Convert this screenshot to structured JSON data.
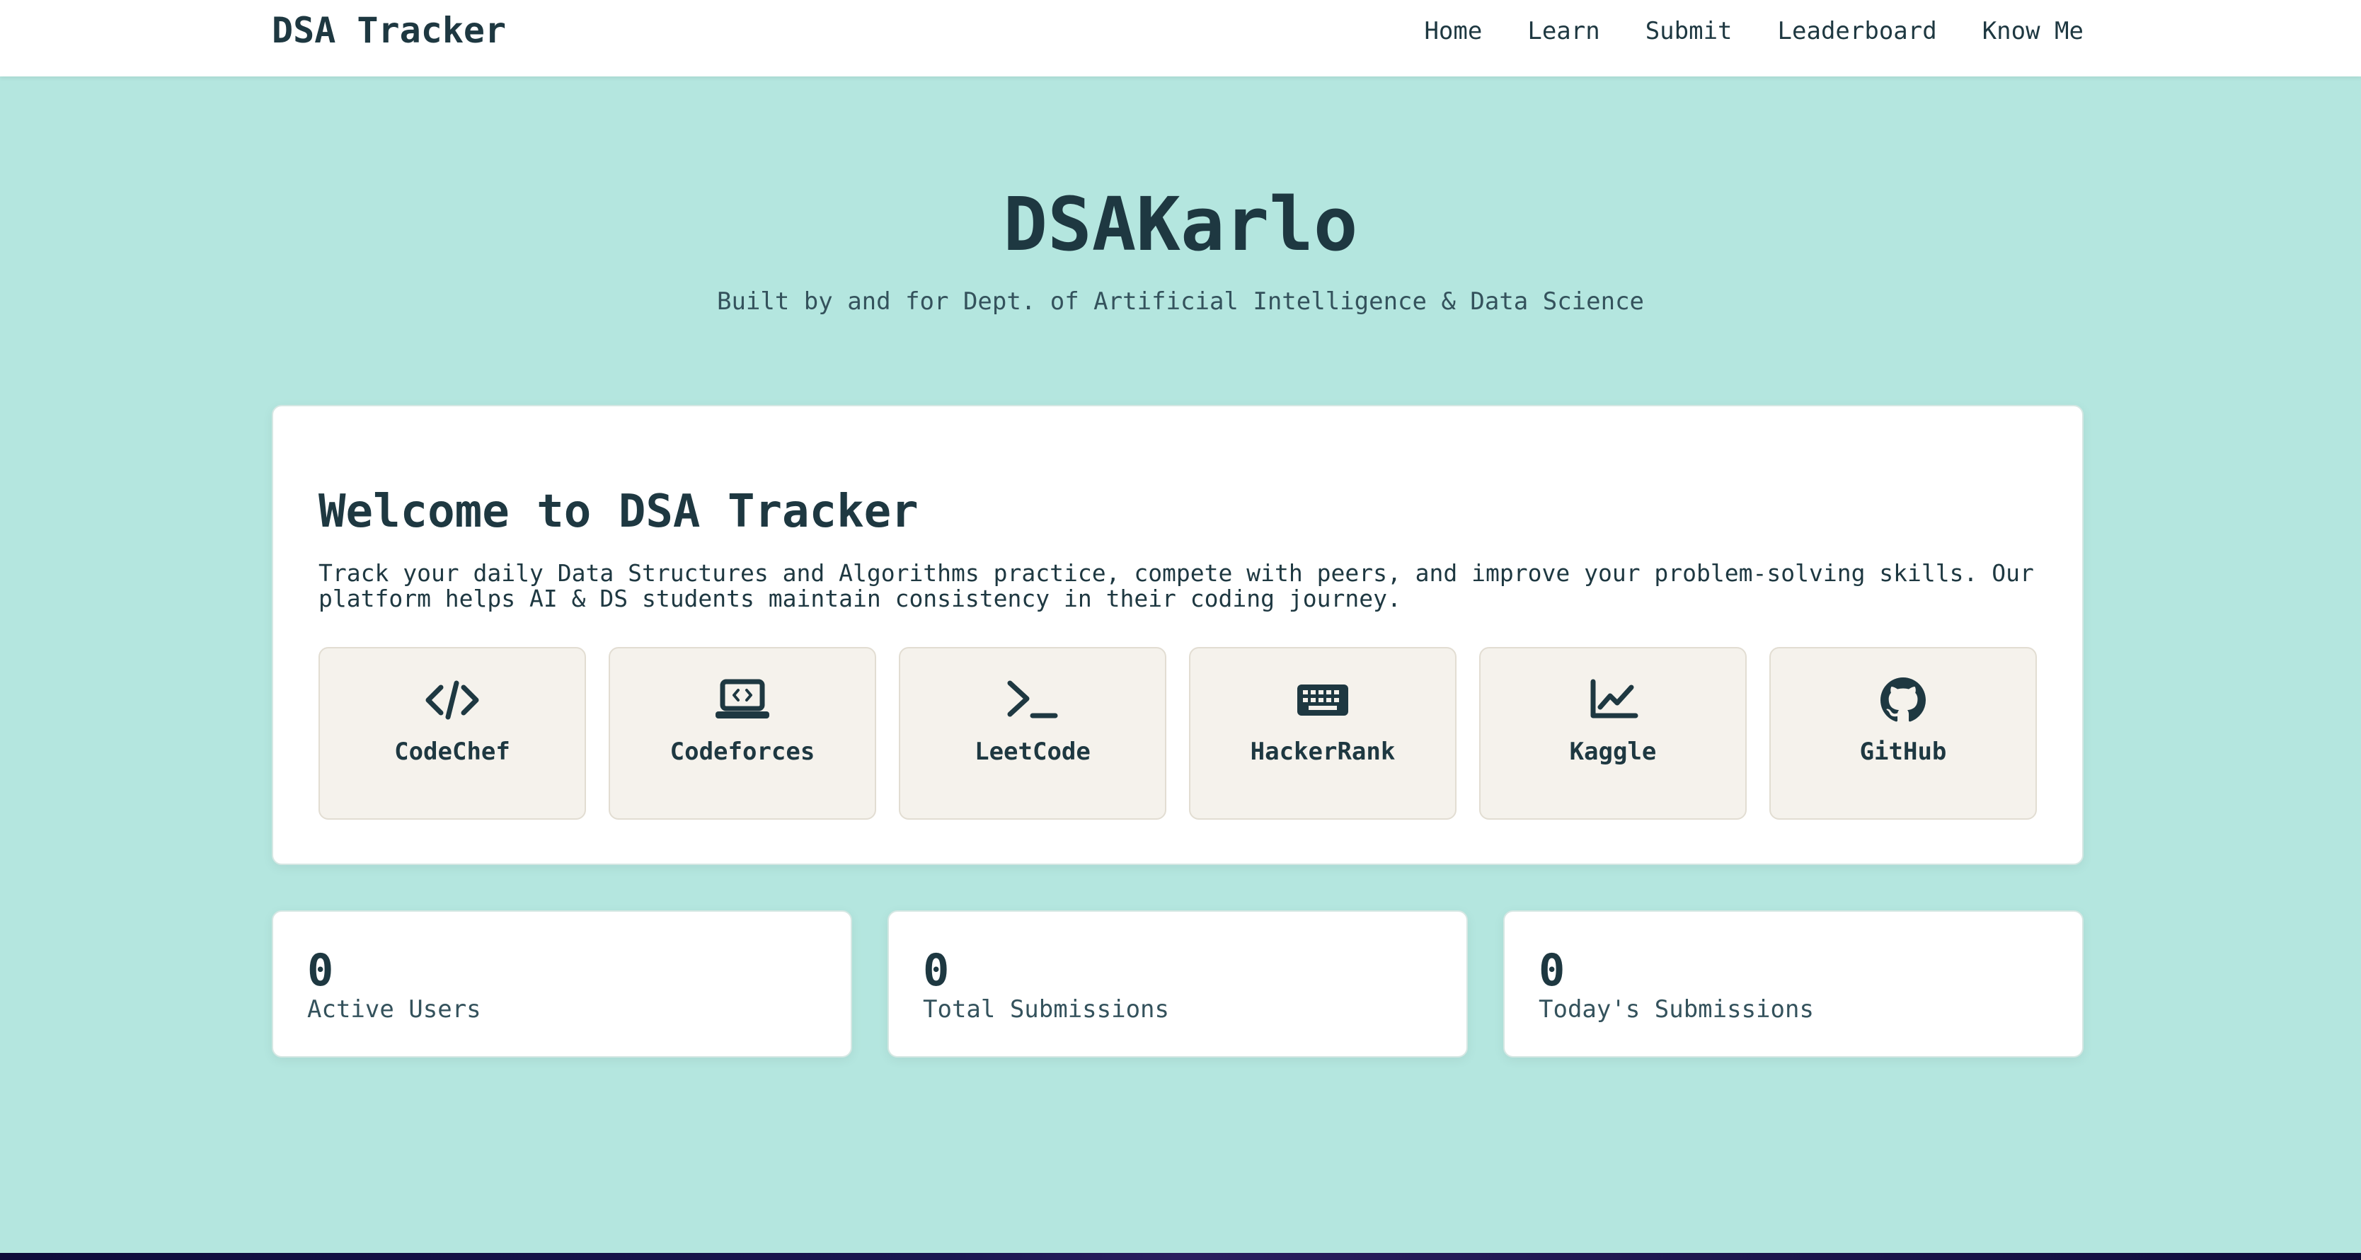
{
  "navbar": {
    "brand": "DSA Tracker",
    "links": [
      "Home",
      "Learn",
      "Submit",
      "Leaderboard",
      "Know Me"
    ]
  },
  "hero": {
    "title": "DSAKarlo",
    "subtitle": "Built by and for Dept. of Artificial Intelligence & Data Science"
  },
  "welcome": {
    "title": "Welcome to DSA Tracker",
    "text": "Track your daily Data Structures and Algorithms practice, compete with peers, and improve your problem-solving skills. Our platform helps AI & DS students maintain consistency in their coding journey.",
    "platforms": [
      {
        "name": "CodeChef",
        "icon": "code-icon"
      },
      {
        "name": "Codeforces",
        "icon": "laptop-code-icon"
      },
      {
        "name": "LeetCode",
        "icon": "terminal-icon"
      },
      {
        "name": "HackerRank",
        "icon": "keyboard-icon"
      },
      {
        "name": "Kaggle",
        "icon": "chart-line-icon"
      },
      {
        "name": "GitHub",
        "icon": "github-icon"
      }
    ]
  },
  "stats": [
    {
      "value": "0",
      "label": "Active Users"
    },
    {
      "value": "0",
      "label": "Total Submissions"
    },
    {
      "value": "0",
      "label": "Today's Submissions"
    }
  ],
  "colors": {
    "background": "#b4e6df",
    "text": "#1e3841",
    "tile": "#f5f2ec",
    "card": "#ffffff"
  }
}
